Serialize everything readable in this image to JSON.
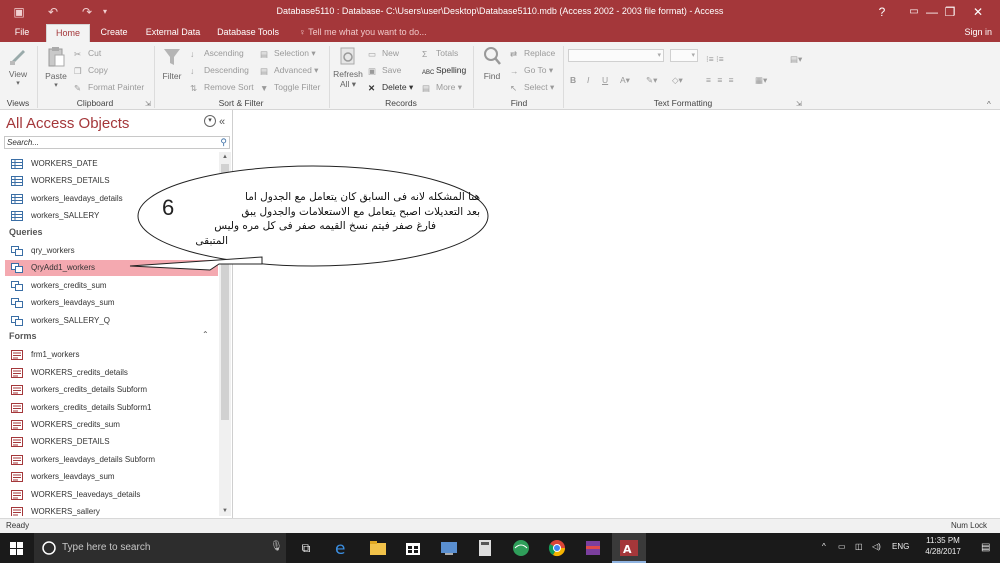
{
  "window": {
    "title": "Database5110 : Database- C:\\Users\\user\\Desktop\\Database5110.mdb (Access 2002 - 2003 file format) - Access",
    "help": "?",
    "minimize": "—",
    "restore": "❐",
    "close": "✕"
  },
  "tabs": [
    "File",
    "Home",
    "Create",
    "External Data",
    "Database Tools"
  ],
  "active_tab": "Home",
  "tell_me": "Tell me what you want to do...",
  "sign_in": "Sign in",
  "ribbon": {
    "views": {
      "view": "View",
      "label": "Views"
    },
    "clipboard": {
      "paste": "Paste",
      "cut": "Cut",
      "copy": "Copy",
      "format_painter": "Format Painter",
      "label": "Clipboard"
    },
    "sort_filter": {
      "filter": "Filter",
      "ascending": "Ascending",
      "descending": "Descending",
      "remove_sort": "Remove Sort",
      "selection": "Selection",
      "advanced": "Advanced",
      "toggle_filter": "Toggle Filter",
      "label": "Sort & Filter"
    },
    "records": {
      "refresh": "Refresh",
      "refresh_all": "All",
      "new": "New",
      "save": "Save",
      "delete": "Delete",
      "totals": "Totals",
      "spelling": "Spelling",
      "more": "More",
      "label": "Records"
    },
    "find": {
      "find": "Find",
      "replace": "Replace",
      "goto": "Go To",
      "select": "Select",
      "label": "Find"
    },
    "text_formatting": {
      "bold": "B",
      "italic": "I",
      "underline": "U",
      "label": "Text Formatting"
    }
  },
  "nav": {
    "title": "All Access Objects",
    "search_placeholder": "Search...",
    "tables": [
      "WORKERS_DATE",
      "WORKERS_DETAILS",
      "workers_leavdays_details",
      "workers_SALLERY"
    ],
    "queries_header": "Queries",
    "queries": [
      "qry_workers",
      "QryAdd1_workers",
      "workers_credits_sum",
      "workers_leavdays_sum",
      "workers_SALLERY_Q"
    ],
    "selected": "QryAdd1_workers",
    "forms_header": "Forms",
    "forms": [
      "frm1_workers",
      "WORKERS_credits_details",
      "workers_credits_details Subform",
      "workers_credits_details Subform1",
      "WORKERS_credits_sum",
      "WORKERS_DETAILS",
      "workers_leavdays_details Subform",
      "workers_leavdays_sum",
      "WORKERS_leavedays_details",
      "WORKERS_sallery"
    ]
  },
  "annotation": {
    "number": "6",
    "lines": [
      "هنا المشكله لانه فى السابق كان يتعامل مع الجدول  اما",
      "بعد التعديلات اصبح يتعامل مع الاستعلامات والجدول يبق",
      "فارغ صفر فيتم نسخ القيمه صفر فى كل مره وليس",
      "المتبقى"
    ]
  },
  "status": {
    "left": "Ready",
    "right": "Num Lock"
  },
  "taskbar": {
    "search_placeholder": "Type here to search",
    "time": "11:35 PM",
    "date": "4/28/2017",
    "lang": "ENG"
  }
}
